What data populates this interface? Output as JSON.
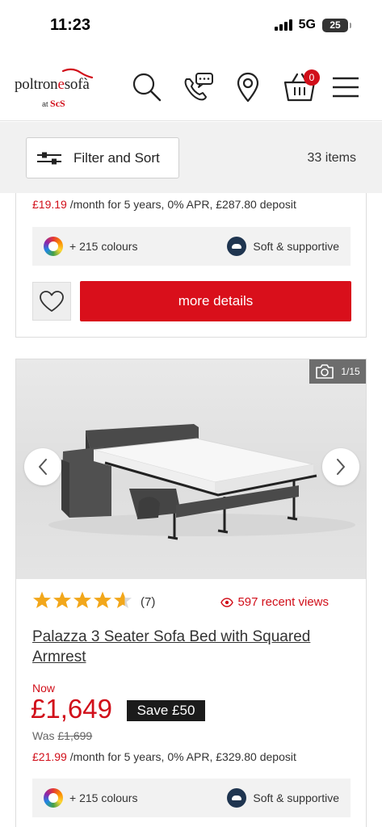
{
  "status_bar": {
    "time": "11:23",
    "network": "5G",
    "battery": "25"
  },
  "header": {
    "logo_main_prefix": "poltron",
    "logo_main_accent": "e",
    "logo_main_suffix": "sofà",
    "logo_sub_prefix": "at",
    "logo_sub_brand": "ScS",
    "cart_count": "0"
  },
  "filter_bar": {
    "filter_label": "Filter and Sort",
    "items_count": "33 items"
  },
  "card1": {
    "finance_price": "£19.19",
    "finance_text": " /month for 5 years, 0% APR, £287.80 deposit",
    "colours_label": "+ 215 colours",
    "comfort_label": "Soft & supportive",
    "details_label": "more details"
  },
  "card2": {
    "photo_counter": "1/15",
    "rating": 4.5,
    "review_count": "(7)",
    "recent_views": "597 recent views",
    "title": "Palazza 3 Seater Sofa Bed with Squared Armrest",
    "now_label": "Now",
    "price": "£1,649",
    "save_label": "Save £50",
    "was_label": "Was",
    "was_price": "£1,699",
    "finance_price": "£21.99",
    "finance_text": " /month for 5 years, 0% APR, £329.80 deposit",
    "colours_label": "+ 215 colours",
    "comfort_label": "Soft & supportive"
  },
  "colors": {
    "brand_red": "#d90f1b",
    "star_gold": "#f2a71b",
    "dark_badge": "#1b1b1b"
  },
  "icons": [
    "search-icon",
    "phone-chat-icon",
    "location-pin-icon",
    "basket-icon",
    "menu-icon",
    "filter-sliders-icon",
    "colour-wheel-icon",
    "soft-supportive-icon",
    "heart-icon",
    "camera-icon",
    "chevron-left-icon",
    "chevron-right-icon",
    "star-icon",
    "eye-icon"
  ]
}
